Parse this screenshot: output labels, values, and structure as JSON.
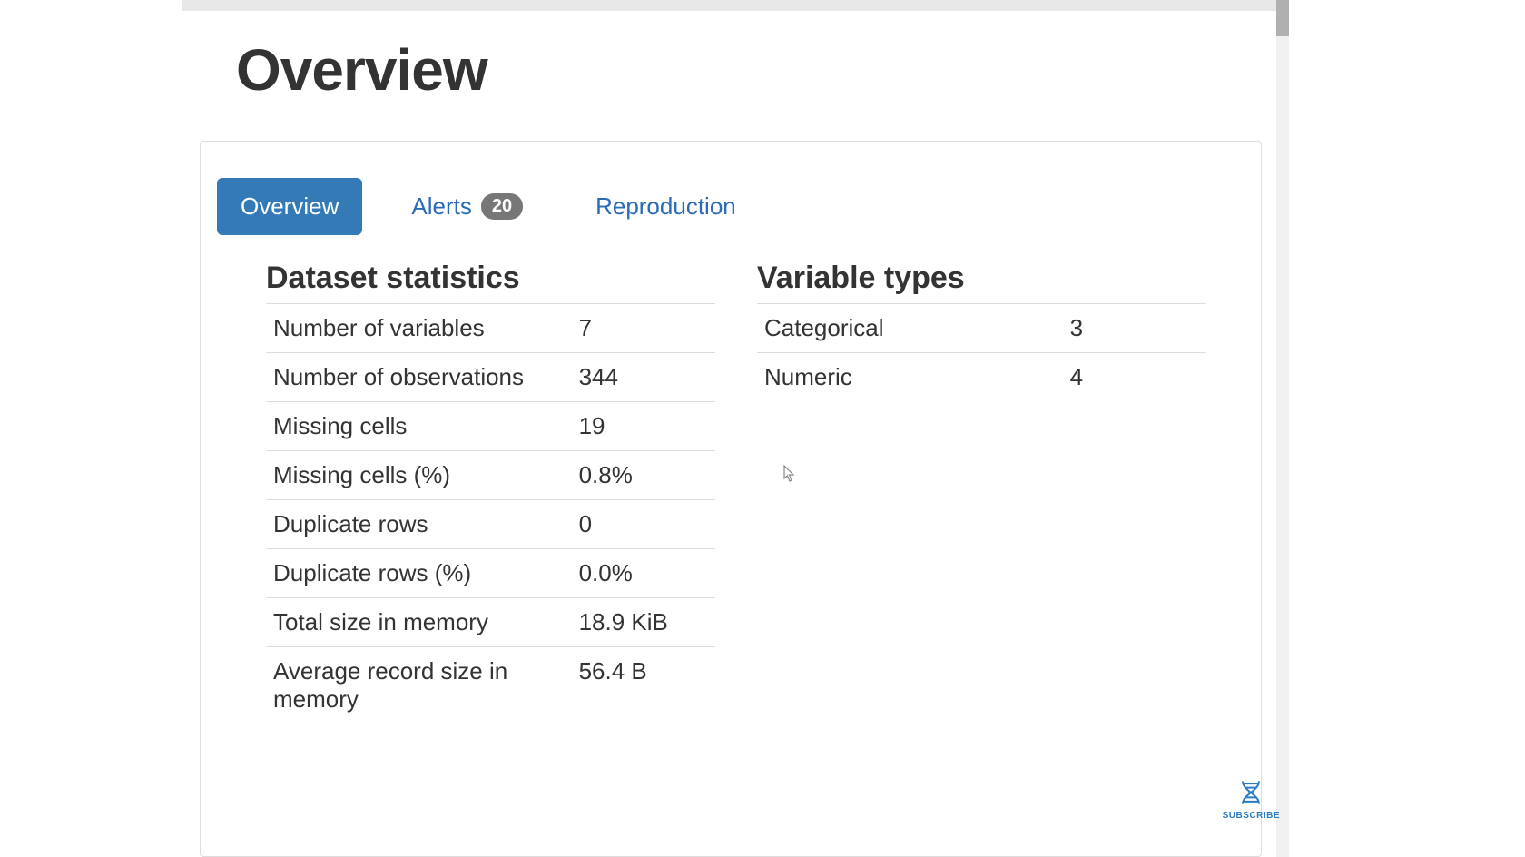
{
  "page": {
    "title": "Overview"
  },
  "tabs": {
    "overview": "Overview",
    "alerts": "Alerts",
    "alerts_count": "20",
    "reproduction": "Reproduction"
  },
  "dataset_stats": {
    "heading": "Dataset statistics",
    "rows": [
      {
        "label": "Number of variables",
        "value": "7"
      },
      {
        "label": "Number of observations",
        "value": "344"
      },
      {
        "label": "Missing cells",
        "value": "19"
      },
      {
        "label": "Missing cells (%)",
        "value": "0.8%"
      },
      {
        "label": "Duplicate rows",
        "value": "0"
      },
      {
        "label": "Duplicate rows (%)",
        "value": "0.0%"
      },
      {
        "label": "Total size in memory",
        "value": "18.9 KiB"
      },
      {
        "label": "Average record size in memory",
        "value": "56.4 B"
      }
    ]
  },
  "variable_types": {
    "heading": "Variable types",
    "rows": [
      {
        "label": "Categorical",
        "value": "3"
      },
      {
        "label": "Numeric",
        "value": "4"
      }
    ]
  },
  "subscribe": {
    "label": "SUBSCRIBE"
  }
}
